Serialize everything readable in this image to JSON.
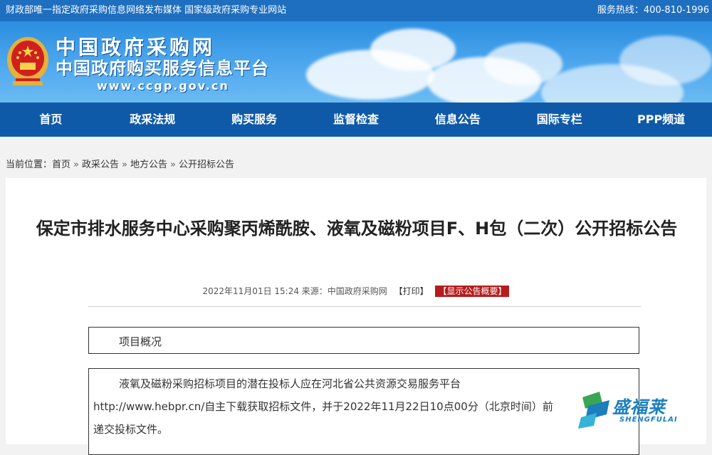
{
  "topbar": {
    "left_text": "财政部唯一指定政府采购信息网络发布媒体 国家级政府采购专业网站",
    "hotline": "服务热线：400-810-1996"
  },
  "header": {
    "emblem_icon": "national-emblem-icon",
    "name_line1": "中国政府采购网",
    "name_line2": "中国政府购买服务信息平台",
    "url": "www.ccgp.gov.cn"
  },
  "nav": {
    "items": [
      "首页",
      "政采法规",
      "购买服务",
      "监督检查",
      "信息公告",
      "国际专栏",
      "PPP频道"
    ]
  },
  "breadcrumb": {
    "prefix": "当前位置：",
    "items": [
      "首页",
      "政采公告",
      "地方公告",
      "公开招标公告"
    ],
    "sep": "»"
  },
  "article": {
    "title": "保定市排水服务中心采购聚丙烯酰胺、液氧及磁粉项目F、H包（二次）公开招标公告",
    "meta_date": "2022年11月01日 15:24 来源：中国政府采购网",
    "print_label": "【打印】",
    "summary_label": "【显示公告概要】",
    "section1": "项目概况",
    "para_lines": [
      "液氧及磁粉采购招标项目的潜在投标人应在河北省公共资源交易服务平台",
      "http://www.hebpr.cn/自主下载获取招标文件，并于2022年11月22日10点00分（北京时间）前",
      "递交投标文件。"
    ]
  },
  "watermark": {
    "name_cn": "盛福莱",
    "name_en": "SHENGFULAI",
    "colors": {
      "primary": "#1b7fbe",
      "accent": "#3aa654"
    }
  },
  "colors": {
    "nav_bg": "#0f5aa8",
    "topbar_bg": "#1e6fc0",
    "summary_btn": "#b61c1c"
  }
}
